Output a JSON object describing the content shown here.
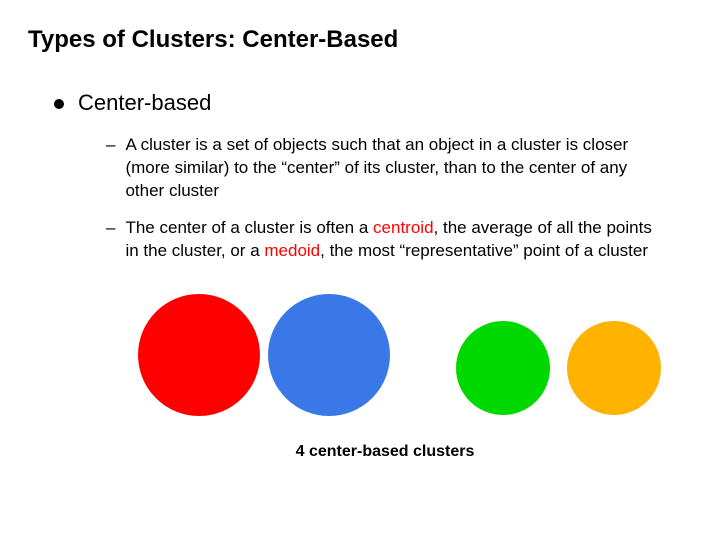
{
  "title": "Types of Clusters: Center-Based",
  "heading": "Center-based",
  "sub1_a": "A cluster is a set of objects such that an object in a cluster is closer (more similar) to the “center” of its cluster, than to the center of any other cluster",
  "sub2_a": "The center of a cluster is often a ",
  "sub2_k1": "centroid",
  "sub2_b": ", the average of all the points in the cluster, or a ",
  "sub2_k2": "medoid",
  "sub2_c": ", the most “representative” point of a cluster",
  "caption": "4 center-based clusters",
  "circles": {
    "red": "#ff0000",
    "blue": "#3b78e7",
    "green": "#00d900",
    "orange": "#ffb300"
  }
}
